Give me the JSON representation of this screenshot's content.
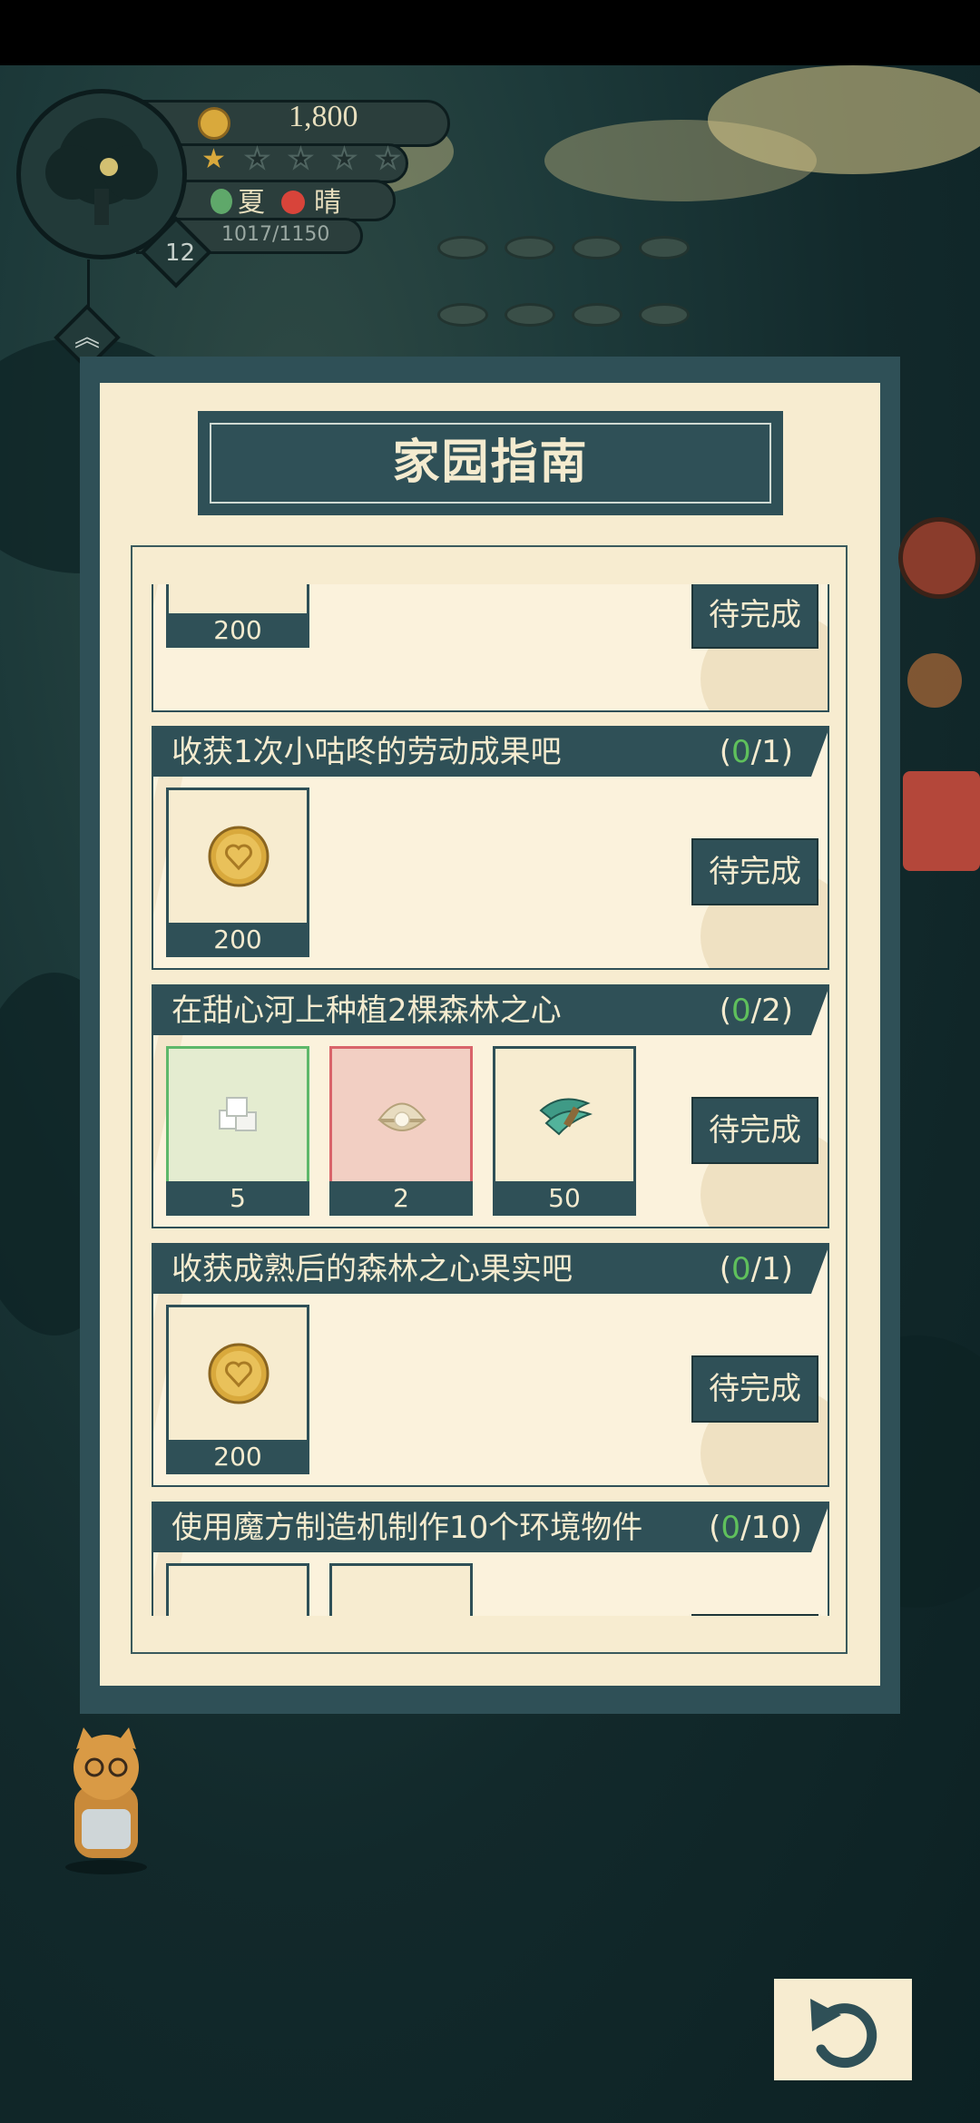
{
  "hud": {
    "coins": "1,800",
    "season": "夏",
    "weather": "晴",
    "xp": "1017/1150",
    "level": "12",
    "stars_filled": 1,
    "stars_total": 5
  },
  "modal": {
    "title": "家园指南",
    "tasks": [
      {
        "title": "",
        "progress_done": "",
        "progress_total": "",
        "rewards": [
          {
            "count": "200",
            "icon": "heart-coin-icon"
          }
        ],
        "button": "待完成"
      },
      {
        "title": "收获1次小咕咚的劳动成果吧",
        "progress_done": "0",
        "progress_total": "1",
        "rewards": [
          {
            "count": "200",
            "icon": "heart-coin-icon"
          }
        ],
        "button": "待完成"
      },
      {
        "title": "在甜心河上种植2棵森林之心",
        "progress_done": "0",
        "progress_total": "2",
        "rewards": [
          {
            "count": "5",
            "icon": "sugar-cube-icon"
          },
          {
            "count": "2",
            "icon": "pearl-shell-icon"
          },
          {
            "count": "50",
            "icon": "leaf-bundle-icon"
          }
        ],
        "button": "待完成"
      },
      {
        "title": "收获成熟后的森林之心果实吧",
        "progress_done": "0",
        "progress_total": "1",
        "rewards": [
          {
            "count": "200",
            "icon": "heart-coin-icon"
          }
        ],
        "button": "待完成"
      },
      {
        "title": "使用魔方制造机制作10个环境物件",
        "progress_done": "0",
        "progress_total": "10",
        "rewards": [
          {
            "count": "",
            "icon": "wood-item-icon"
          },
          {
            "count": "",
            "icon": "plant-item-icon"
          }
        ],
        "button": ""
      }
    ]
  },
  "colors": {
    "panel": "#2f5057",
    "paper": "#f7ecd0",
    "progress_done": "#5fc05c"
  }
}
